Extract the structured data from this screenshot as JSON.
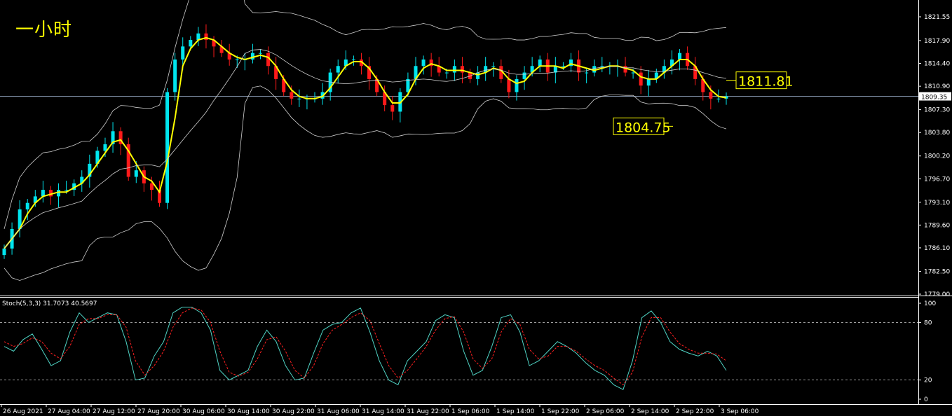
{
  "title": "一小时",
  "current_price_label": "1809.35",
  "stoch_label": "Stoch(5,3,3) 31.7073 40.5697",
  "chart_data": [
    {
      "type": "candlestick",
      "title": "一小时",
      "price_axis_ticks": [
        "1821.55",
        "1817.90",
        "1814.40",
        "1810.90",
        "1807.30",
        "1803.80",
        "1800.20",
        "1796.70",
        "1793.10",
        "1789.60",
        "1786.10",
        "1782.50",
        "1779.00"
      ],
      "current_price": 1809.35,
      "annotations": [
        {
          "label": "1811.81",
          "value": 1811.81
        },
        {
          "label": "1804.75",
          "value": 1804.75
        }
      ],
      "time_axis_labels": [
        "26 Aug 2021",
        "27 Aug 04:00",
        "27 Aug 12:00",
        "27 Aug 20:00",
        "30 Aug 06:00",
        "30 Aug 14:00",
        "30 Aug 22:00",
        "31 Aug 06:00",
        "31 Aug 14:00",
        "31 Aug 22:00",
        "1 Sep 06:00",
        "1 Sep 14:00",
        "1 Sep 22:00",
        "2 Sep 06:00",
        "2 Sep 14:00",
        "2 Sep 22:00",
        "3 Sep 06:00"
      ],
      "close_series": [
        1786,
        1789,
        1792,
        1793,
        1794,
        1795,
        1794,
        1795,
        1795,
        1796,
        1797,
        1799,
        1801,
        1802,
        1804,
        1802,
        1797,
        1798,
        1796,
        1795,
        1793,
        1810,
        1815,
        1817,
        1818,
        1819,
        1818,
        1817,
        1816,
        1815,
        1815,
        1815,
        1816,
        1816,
        1814,
        1812,
        1810,
        1809,
        1809,
        1809,
        1809,
        1810,
        1813,
        1814,
        1815,
        1815,
        1814,
        1812,
        1810,
        1808,
        1807,
        1810,
        1812,
        1814,
        1815,
        1814,
        1813,
        1813,
        1814,
        1813,
        1812,
        1813,
        1814,
        1814,
        1812,
        1810,
        1812,
        1813,
        1814,
        1815,
        1813,
        1814,
        1814,
        1815,
        1813,
        1813,
        1814,
        1814,
        1814,
        1814,
        1813,
        1813,
        1811,
        1812,
        1813,
        1814,
        1815,
        1816,
        1814,
        1812,
        1810,
        1809,
        1809,
        1809.35
      ],
      "bollinger": {
        "upper_end": 1817.5,
        "middle_end": 1811.81,
        "lower_end": 1806.9
      },
      "moving_average_color": "#ffff00",
      "bull_color": "#00e5ee",
      "bear_color": "#ff1a1a"
    },
    {
      "type": "line",
      "title": "Stoch(5,3,3)",
      "yticks": [
        "100",
        "80",
        "20",
        "0"
      ],
      "levels": [
        80,
        20
      ],
      "series": [
        {
          "name": "main",
          "color": "#4fd3c4",
          "values": [
            55,
            50,
            62,
            68,
            52,
            35,
            40,
            70,
            90,
            80,
            85,
            90,
            88,
            60,
            20,
            22,
            45,
            60,
            90,
            96,
            96,
            90,
            72,
            30,
            20,
            25,
            30,
            55,
            72,
            60,
            35,
            20,
            22,
            48,
            72,
            78,
            80,
            90,
            95,
            70,
            40,
            20,
            15,
            40,
            50,
            60,
            82,
            88,
            85,
            50,
            25,
            30,
            55,
            85,
            88,
            70,
            35,
            40,
            50,
            60,
            55,
            48,
            38,
            30,
            25,
            15,
            10,
            40,
            85,
            92,
            80,
            60,
            52,
            48,
            45,
            50,
            45,
            30
          ]
        },
        {
          "name": "signal",
          "color": "#ff2020",
          "values": [
            60,
            55,
            58,
            64,
            60,
            48,
            42,
            55,
            78,
            84,
            84,
            88,
            88,
            75,
            40,
            25,
            35,
            50,
            75,
            90,
            95,
            93,
            80,
            50,
            28,
            24,
            28,
            42,
            62,
            65,
            50,
            30,
            22,
            35,
            58,
            72,
            78,
            85,
            90,
            82,
            58,
            35,
            22,
            30,
            42,
            55,
            72,
            84,
            86,
            70,
            42,
            32,
            42,
            70,
            84,
            78,
            52,
            42,
            45,
            55,
            55,
            50,
            42,
            35,
            30,
            22,
            15,
            28,
            65,
            85,
            85,
            70,
            58,
            52,
            48,
            48,
            47,
            40
          ]
        }
      ]
    }
  ]
}
